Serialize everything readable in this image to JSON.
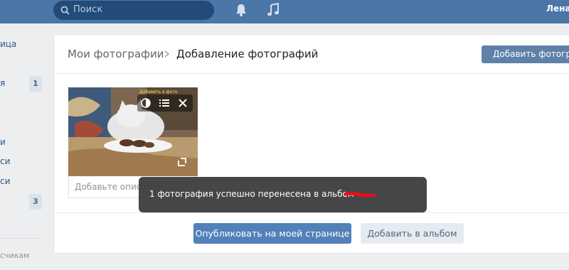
{
  "header": {
    "search_placeholder": "Поиск",
    "user_name": "Лена"
  },
  "left_nav": {
    "items": [
      {
        "label": "ица"
      },
      {
        "label": "я",
        "badge": "1"
      },
      {
        "label": "и"
      },
      {
        "label": "си"
      },
      {
        "label": "си"
      },
      {
        "label": "",
        "badge": "3"
      }
    ],
    "footer": "счикам"
  },
  "breadcrumb": {
    "root": "Мои фотографии",
    "current": "Добавление фотографий"
  },
  "top_button": "Добавить фотографии",
  "photo": {
    "overlay_text": "Добавить в фото",
    "description_placeholder": "Добавьте описание"
  },
  "footer": {
    "publish_button": "Опубликовать на моей странице",
    "album_button": "Добавить в альбом"
  },
  "toast": {
    "message": "1 фотография успешно перенесена в альбом"
  },
  "colors": {
    "header": "#4a76a8",
    "primary_button": "#5181b8",
    "secondary_button": "#e5ebf1",
    "toast": "#3c3c3c"
  }
}
